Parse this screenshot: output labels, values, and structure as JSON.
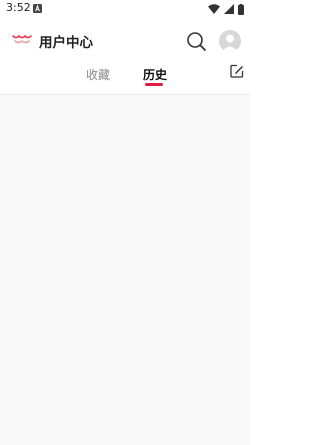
{
  "status_bar": {
    "time": "3:52",
    "icons": [
      "a-notification-icon",
      "wifi-icon",
      "signal-icon",
      "battery-icon"
    ]
  },
  "header": {
    "title": "用户中心",
    "logo": "logo-icon",
    "search": "search-icon",
    "avatar": "avatar-icon"
  },
  "tabs": [
    {
      "label": "收藏",
      "active": false
    },
    {
      "label": "历史",
      "active": true
    }
  ],
  "edit": "edit-icon",
  "colors": {
    "accent": "#e21a44",
    "background": "#f8f8f8",
    "text": "#222222",
    "muted": "#888888"
  }
}
